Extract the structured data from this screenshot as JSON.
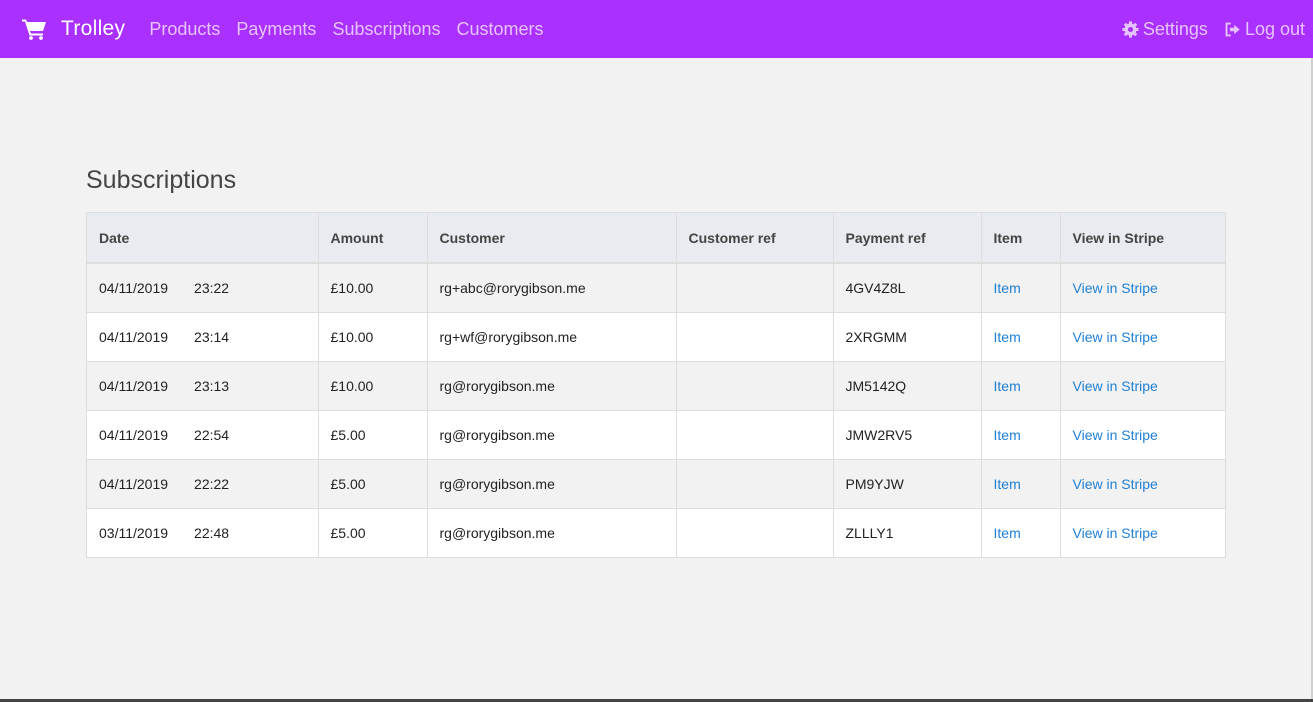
{
  "navbar": {
    "brand": "Trolley",
    "cart_icon": "shopping-cart-icon",
    "links": [
      "Products",
      "Payments",
      "Subscriptions",
      "Customers"
    ],
    "settings_label": "Settings",
    "settings_icon": "gear-icon",
    "logout_label": "Log out",
    "logout_icon": "sign-out-icon",
    "background_color": "#aa30ff",
    "link_color": "#e6c2ff"
  },
  "page": {
    "title": "Subscriptions"
  },
  "table": {
    "headers": [
      "Date",
      "Amount",
      "Customer",
      "Customer ref",
      "Payment ref",
      "Item",
      "View in Stripe"
    ],
    "rows": [
      {
        "date": "04/11/2019",
        "time": "23:22",
        "amount": "£10.00",
        "customer": "rg+abc@rorygibson.me",
        "customer_ref": "",
        "payment_ref": "4GV4Z8L",
        "item": "Item",
        "stripe": "View in Stripe"
      },
      {
        "date": "04/11/2019",
        "time": "23:14",
        "amount": "£10.00",
        "customer": "rg+wf@rorygibson.me",
        "customer_ref": "",
        "payment_ref": "2XRGMM",
        "item": "Item",
        "stripe": "View in Stripe"
      },
      {
        "date": "04/11/2019",
        "time": "23:13",
        "amount": "£10.00",
        "customer": "rg@rorygibson.me",
        "customer_ref": "",
        "payment_ref": "JM5142Q",
        "item": "Item",
        "stripe": "View in Stripe"
      },
      {
        "date": "04/11/2019",
        "time": "22:54",
        "amount": "£5.00",
        "customer": "rg@rorygibson.me",
        "customer_ref": "",
        "payment_ref": "JMW2RV5",
        "item": "Item",
        "stripe": "View in Stripe"
      },
      {
        "date": "04/11/2019",
        "time": "22:22",
        "amount": "£5.00",
        "customer": "rg@rorygibson.me",
        "customer_ref": "",
        "payment_ref": "PM9YJW",
        "item": "Item",
        "stripe": "View in Stripe"
      },
      {
        "date": "03/11/2019",
        "time": "22:48",
        "amount": "£5.00",
        "customer": "rg@rorygibson.me",
        "customer_ref": "",
        "payment_ref": "ZLLLY1",
        "item": "Item",
        "stripe": "View in Stripe"
      }
    ],
    "link_color": "#1e7fd6"
  }
}
